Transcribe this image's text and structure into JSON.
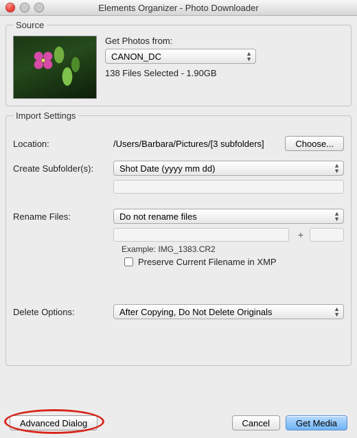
{
  "window": {
    "title": "Elements Organizer - Photo Downloader"
  },
  "source": {
    "legend": "Source",
    "get_from_label": "Get Photos from:",
    "device_selected": "CANON_DC",
    "status": "138 Files Selected - 1.90GB"
  },
  "import": {
    "legend": "Import Settings",
    "location_label": "Location:",
    "location_path": "/Users/Barbara/Pictures/[3 subfolders]",
    "choose_label": "Choose...",
    "subfolders_label": "Create Subfolder(s):",
    "subfolders_selected": "Shot Date (yyyy mm dd)",
    "rename_label": "Rename Files:",
    "rename_selected": "Do not rename files",
    "rename_suffix_plus": "+",
    "example_text": "Example:  IMG_1383.CR2",
    "preserve_xmp_label": "Preserve Current Filename in XMP",
    "delete_label": "Delete Options:",
    "delete_selected": "After Copying, Do Not Delete Originals"
  },
  "footer": {
    "advanced_label": "Advanced Dialog",
    "cancel_label": "Cancel",
    "get_media_label": "Get Media"
  }
}
